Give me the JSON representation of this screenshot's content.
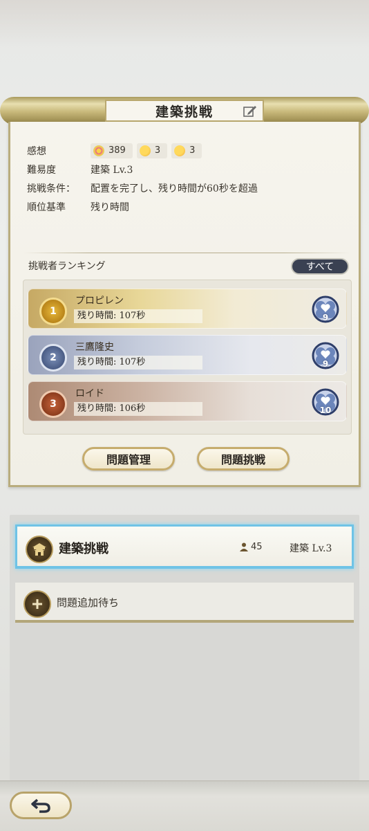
{
  "header": {
    "title": "建築挑戦"
  },
  "info": {
    "impressions_label": "感想",
    "impressions": [
      {
        "icon": "party-emoji-icon",
        "value": "389"
      },
      {
        "icon": "thinking-emoji-icon",
        "value": "3"
      },
      {
        "icon": "smile-emoji-icon",
        "value": "3"
      }
    ],
    "difficulty_label": "難易度",
    "difficulty_value": "建築 Lv.3",
    "condition_label": "挑戦条件：",
    "condition_value": "配置を完了し、残り時間が60秒を超過",
    "ranking_basis_label": "順位基準",
    "ranking_basis_value": "残り時間"
  },
  "ranking": {
    "title": "挑戦者ランキング",
    "all_button": "すべて",
    "entries": [
      {
        "rank": "1",
        "name": "プロピレン",
        "time": "残り時間: 107秒",
        "likes": "9"
      },
      {
        "rank": "2",
        "name": "三鷹隆史",
        "time": "残り時間: 107秒",
        "likes": "9"
      },
      {
        "rank": "3",
        "name": "ロイド",
        "time": "残り時間: 106秒",
        "likes": "10"
      }
    ]
  },
  "actions": {
    "manage_button": "問題管理",
    "challenge_button": "問題挑戦"
  },
  "list": {
    "selected": {
      "title": "建築挑戦",
      "users": "45",
      "level": "建築 Lv.3"
    },
    "add_label": "問題追加待ち"
  },
  "colors": {
    "select_glow": "#6fc3e6",
    "gold": "#c6a964",
    "silver": "#9aa3bc",
    "bronze": "#ad8a74"
  }
}
